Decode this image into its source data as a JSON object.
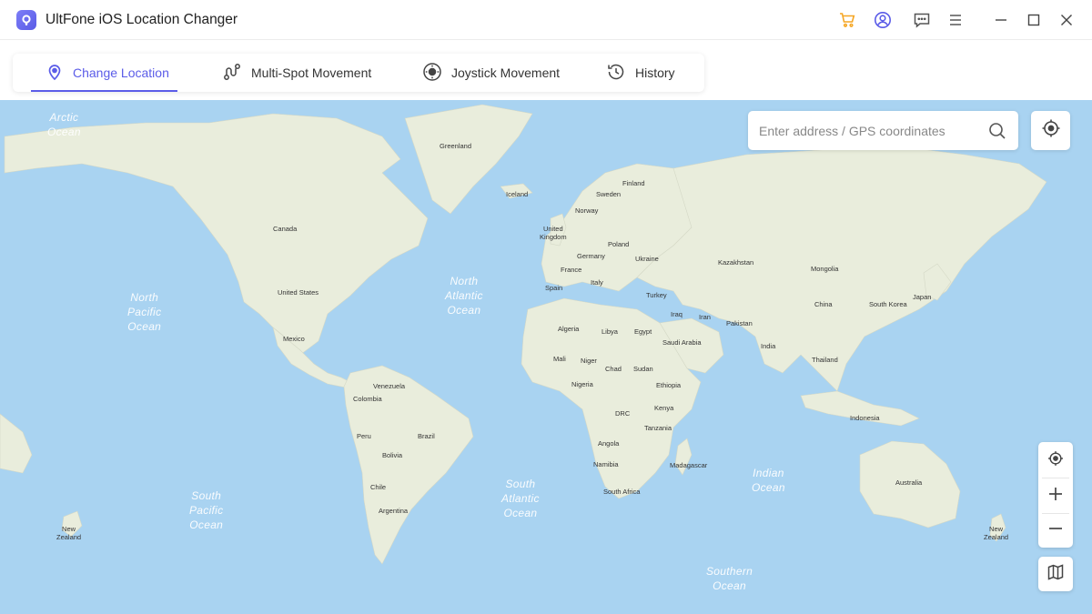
{
  "window": {
    "title": "UltFone iOS Location Changer",
    "icons": [
      "cart-icon",
      "account-icon",
      "feedback-icon",
      "menu-icon",
      "minimize-icon",
      "maximize-icon",
      "close-icon"
    ],
    "accent": "#5b5ce8",
    "cart_color": "#f5a623"
  },
  "tabs": [
    {
      "label": "Change Location",
      "icon": "location-pin-icon",
      "active": true
    },
    {
      "label": "Multi-Spot Movement",
      "icon": "route-icon",
      "active": false
    },
    {
      "label": "Joystick Movement",
      "icon": "joystick-icon",
      "active": false
    },
    {
      "label": "History",
      "icon": "history-icon",
      "active": false
    }
  ],
  "search": {
    "placeholder": "Enter address / GPS coordinates",
    "value": ""
  },
  "map": {
    "ocean_color": "#a9d3f1",
    "land_color": "#e9eddc",
    "countries": {
      "greenland": "Greenland",
      "iceland": "Iceland",
      "finland": "Finland",
      "sweden": "Sweden",
      "norway": "Norway",
      "uk": "United\nKingdom",
      "poland": "Poland",
      "germany": "Germany",
      "ukraine": "Ukraine",
      "france": "France",
      "kazakhstan": "Kazakhstan",
      "mongolia": "Mongolia",
      "spain": "Spain",
      "italy": "Italy",
      "turkey": "Turkey",
      "china": "China",
      "south_korea": "South Korea",
      "japan": "Japan",
      "iraq": "Iraq",
      "iran": "Iran",
      "pakistan": "Pakistan",
      "algeria": "Algeria",
      "libya": "Libya",
      "egypt": "Egypt",
      "saudi_arabia": "Saudi Arabia",
      "india": "India",
      "mali": "Mali",
      "niger": "Niger",
      "chad": "Chad",
      "sudan": "Sudan",
      "thailand": "Thailand",
      "nigeria": "Nigeria",
      "ethiopia": "Ethiopia",
      "kenya": "Kenya",
      "drc": "DRC",
      "tanzania": "Tanzania",
      "indonesia": "Indonesia",
      "angola": "Angola",
      "namibia": "Namibia",
      "madagascar": "Madagascar",
      "south_africa": "South Africa",
      "australia": "Australia",
      "canada": "Canada",
      "united_states": "United States",
      "mexico": "Mexico",
      "venezuela": "Venezuela",
      "colombia": "Colombia",
      "peru": "Peru",
      "brazil": "Brazil",
      "bolivia": "Bolivia",
      "chile": "Chile",
      "argentina": "Argentina",
      "new_zealand_left": "New\nZealand",
      "new_zealand_right": "New\nZealand"
    },
    "oceans": {
      "arctic": "Arctic\nOcean",
      "north_pacific": "North\nPacific\nOcean",
      "north_atlantic": "North\nAtlantic\nOcean",
      "south_pacific": "South\nPacific\nOcean",
      "south_atlantic": "South\nAtlantic\nOcean",
      "indian": "Indian\nOcean",
      "southern": "Southern\nOcean"
    },
    "controls": [
      "locate-icon",
      "zoom-in-icon",
      "zoom-out-icon",
      "map-layers-icon"
    ]
  }
}
